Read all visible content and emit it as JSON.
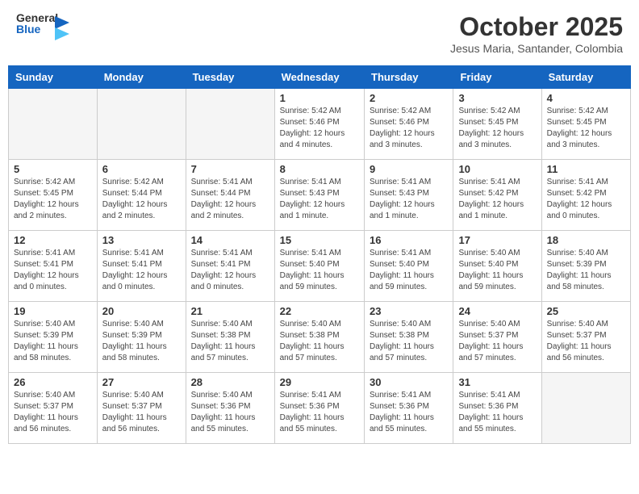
{
  "header": {
    "logo_general": "General",
    "logo_blue": "Blue",
    "month_title": "October 2025",
    "location": "Jesus Maria, Santander, Colombia"
  },
  "days_of_week": [
    "Sunday",
    "Monday",
    "Tuesday",
    "Wednesday",
    "Thursday",
    "Friday",
    "Saturday"
  ],
  "weeks": [
    [
      {
        "day": "",
        "info": ""
      },
      {
        "day": "",
        "info": ""
      },
      {
        "day": "",
        "info": ""
      },
      {
        "day": "1",
        "info": "Sunrise: 5:42 AM\nSunset: 5:46 PM\nDaylight: 12 hours\nand 4 minutes."
      },
      {
        "day": "2",
        "info": "Sunrise: 5:42 AM\nSunset: 5:46 PM\nDaylight: 12 hours\nand 3 minutes."
      },
      {
        "day": "3",
        "info": "Sunrise: 5:42 AM\nSunset: 5:45 PM\nDaylight: 12 hours\nand 3 minutes."
      },
      {
        "day": "4",
        "info": "Sunrise: 5:42 AM\nSunset: 5:45 PM\nDaylight: 12 hours\nand 3 minutes."
      }
    ],
    [
      {
        "day": "5",
        "info": "Sunrise: 5:42 AM\nSunset: 5:45 PM\nDaylight: 12 hours\nand 2 minutes."
      },
      {
        "day": "6",
        "info": "Sunrise: 5:42 AM\nSunset: 5:44 PM\nDaylight: 12 hours\nand 2 minutes."
      },
      {
        "day": "7",
        "info": "Sunrise: 5:41 AM\nSunset: 5:44 PM\nDaylight: 12 hours\nand 2 minutes."
      },
      {
        "day": "8",
        "info": "Sunrise: 5:41 AM\nSunset: 5:43 PM\nDaylight: 12 hours\nand 1 minute."
      },
      {
        "day": "9",
        "info": "Sunrise: 5:41 AM\nSunset: 5:43 PM\nDaylight: 12 hours\nand 1 minute."
      },
      {
        "day": "10",
        "info": "Sunrise: 5:41 AM\nSunset: 5:42 PM\nDaylight: 12 hours\nand 1 minute."
      },
      {
        "day": "11",
        "info": "Sunrise: 5:41 AM\nSunset: 5:42 PM\nDaylight: 12 hours\nand 0 minutes."
      }
    ],
    [
      {
        "day": "12",
        "info": "Sunrise: 5:41 AM\nSunset: 5:41 PM\nDaylight: 12 hours\nand 0 minutes."
      },
      {
        "day": "13",
        "info": "Sunrise: 5:41 AM\nSunset: 5:41 PM\nDaylight: 12 hours\nand 0 minutes."
      },
      {
        "day": "14",
        "info": "Sunrise: 5:41 AM\nSunset: 5:41 PM\nDaylight: 12 hours\nand 0 minutes."
      },
      {
        "day": "15",
        "info": "Sunrise: 5:41 AM\nSunset: 5:40 PM\nDaylight: 11 hours\nand 59 minutes."
      },
      {
        "day": "16",
        "info": "Sunrise: 5:41 AM\nSunset: 5:40 PM\nDaylight: 11 hours\nand 59 minutes."
      },
      {
        "day": "17",
        "info": "Sunrise: 5:40 AM\nSunset: 5:40 PM\nDaylight: 11 hours\nand 59 minutes."
      },
      {
        "day": "18",
        "info": "Sunrise: 5:40 AM\nSunset: 5:39 PM\nDaylight: 11 hours\nand 58 minutes."
      }
    ],
    [
      {
        "day": "19",
        "info": "Sunrise: 5:40 AM\nSunset: 5:39 PM\nDaylight: 11 hours\nand 58 minutes."
      },
      {
        "day": "20",
        "info": "Sunrise: 5:40 AM\nSunset: 5:39 PM\nDaylight: 11 hours\nand 58 minutes."
      },
      {
        "day": "21",
        "info": "Sunrise: 5:40 AM\nSunset: 5:38 PM\nDaylight: 11 hours\nand 57 minutes."
      },
      {
        "day": "22",
        "info": "Sunrise: 5:40 AM\nSunset: 5:38 PM\nDaylight: 11 hours\nand 57 minutes."
      },
      {
        "day": "23",
        "info": "Sunrise: 5:40 AM\nSunset: 5:38 PM\nDaylight: 11 hours\nand 57 minutes."
      },
      {
        "day": "24",
        "info": "Sunrise: 5:40 AM\nSunset: 5:37 PM\nDaylight: 11 hours\nand 57 minutes."
      },
      {
        "day": "25",
        "info": "Sunrise: 5:40 AM\nSunset: 5:37 PM\nDaylight: 11 hours\nand 56 minutes."
      }
    ],
    [
      {
        "day": "26",
        "info": "Sunrise: 5:40 AM\nSunset: 5:37 PM\nDaylight: 11 hours\nand 56 minutes."
      },
      {
        "day": "27",
        "info": "Sunrise: 5:40 AM\nSunset: 5:37 PM\nDaylight: 11 hours\nand 56 minutes."
      },
      {
        "day": "28",
        "info": "Sunrise: 5:40 AM\nSunset: 5:36 PM\nDaylight: 11 hours\nand 55 minutes."
      },
      {
        "day": "29",
        "info": "Sunrise: 5:41 AM\nSunset: 5:36 PM\nDaylight: 11 hours\nand 55 minutes."
      },
      {
        "day": "30",
        "info": "Sunrise: 5:41 AM\nSunset: 5:36 PM\nDaylight: 11 hours\nand 55 minutes."
      },
      {
        "day": "31",
        "info": "Sunrise: 5:41 AM\nSunset: 5:36 PM\nDaylight: 11 hours\nand 55 minutes."
      },
      {
        "day": "",
        "info": ""
      }
    ]
  ]
}
